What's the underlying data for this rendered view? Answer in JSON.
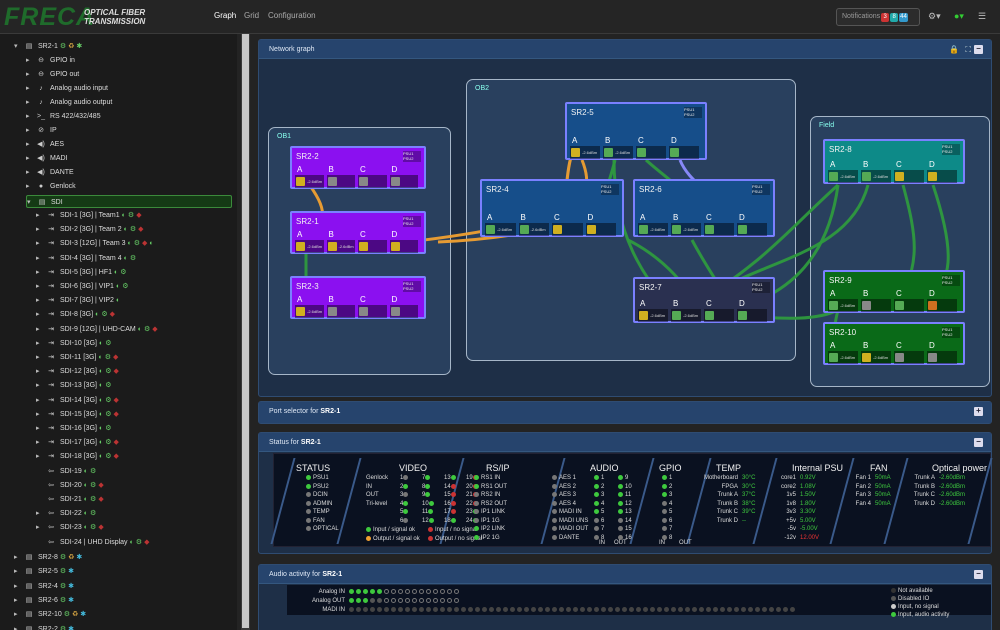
{
  "header": {
    "brand": "FRECA",
    "tagline1": "OPTICAL FIBER",
    "tagline2": "TRANSMISSION",
    "tabs": [
      "Graph",
      "Grid",
      "Configuration"
    ],
    "notifications_label": "Notifications",
    "notif_counts": [
      "3",
      "8",
      "44"
    ]
  },
  "sidebar": {
    "root": "SR2-1",
    "items": [
      "GPIO in",
      "GPIO out",
      "Analog audio input",
      "Analog audio output",
      "RS 422/432/485",
      "IP",
      "AES",
      "MADI",
      "DANTE",
      "Genlock",
      "SDI"
    ],
    "sdi": [
      "SDI-1 [3G] | Team1",
      "SDI-2 [3G] | Team 2",
      "SDI-3 [12G] | Team 3",
      "SDI-4 [3G] | Team 4",
      "SDI-5 [3G] | HF1",
      "SDI-6 [3G] | VIP1",
      "SDI-7 [3G] | VIP2",
      "SDI-8 [3G]",
      "SDI-9 [12G] | UHD-CAM",
      "SDI-10 [3G]",
      "SDI-11 [3G]",
      "SDI-12 [3G]",
      "SDI-13 [3G]",
      "SDI-14 [3G]",
      "SDI-15 [3G]",
      "SDI-16 [3G]",
      "SDI-17 [3G]",
      "SDI-18 [3G]",
      "SDI-19",
      "SDI-20",
      "SDI-21",
      "SDI-22",
      "SDI-23",
      "SDI-24 | UHD Display"
    ],
    "others": [
      "SR2-8",
      "SR2-5",
      "SR2-4",
      "SR2-6",
      "SR2-10",
      "SR2-2"
    ]
  },
  "panels": {
    "graph": "Network graph",
    "port_selector": "Port selector for",
    "status": "Status for",
    "audio": "Audio activity for",
    "device": "SR2-1"
  },
  "graph": {
    "groups": [
      "OB1",
      "OB2",
      "Field"
    ],
    "nodes": [
      "SR2-2",
      "SR2-1",
      "SR2-3",
      "SR2-5",
      "SR2-4",
      "SR2-6",
      "SR2-7",
      "SR2-8",
      "SR2-9",
      "SR2-10"
    ],
    "ports": [
      "A",
      "B",
      "C",
      "D"
    ],
    "psu": [
      "PSU1",
      "PSU2"
    ],
    "levels": [
      "-2.6dBm",
      "-2.6dBm",
      "-2.6dBm"
    ]
  },
  "status": {
    "headers": [
      "STATUS",
      "VIDEO",
      "RS/IP",
      "AUDIO",
      "GPIO",
      "TEMP",
      "Internal PSU",
      "FAN",
      "Optical power"
    ],
    "status_items": [
      "PSU1",
      "PSU2",
      "DCIN",
      "ADMIN",
      "TEMP",
      "FAN",
      "OPTICAL"
    ],
    "video_rows": [
      "Genlock",
      "IN",
      "OUT",
      "Tri-level"
    ],
    "video_legend": [
      "Input / signal ok",
      "Output / signal ok",
      "Input / no signal",
      "Output / no signal"
    ],
    "rsip": [
      "RS1 IN",
      "RS1 OUT",
      "RS2 IN",
      "RS2 OUT",
      "IP1 LINK",
      "IP1 1G",
      "IP2 LINK",
      "IP2 1G"
    ],
    "audio_rows": [
      "AES 1",
      "AES 2",
      "AES 3",
      "AES 4",
      "MADI IN",
      "MADI UNS",
      "MADI OUT",
      "DANTE"
    ],
    "inout": [
      "IN",
      "OUT"
    ],
    "temp": [
      [
        "Motherboard",
        "30°C"
      ],
      [
        "FPGA",
        "30°C"
      ],
      [
        "Trunk A",
        "37°C"
      ],
      [
        "Trunk B",
        "38°C"
      ],
      [
        "Trunk C",
        "39°C"
      ],
      [
        "Trunk D",
        "--"
      ]
    ],
    "psu": [
      [
        "core1",
        "0.92V"
      ],
      [
        "core2",
        "1.08V"
      ],
      [
        "1v5",
        "1.50V"
      ],
      [
        "1v8",
        "1.80V"
      ],
      [
        "3v3",
        "3.30V"
      ],
      [
        "+5v",
        "5.00V"
      ],
      [
        "-5v",
        "-5.00V"
      ],
      [
        "-12v",
        "12.00V"
      ]
    ],
    "fan": [
      [
        "Fan 1",
        "50mA"
      ],
      [
        "Fan 2",
        "50mA"
      ],
      [
        "Fan 3",
        "50mA"
      ],
      [
        "Fan 4",
        "50mA"
      ]
    ],
    "optical": [
      [
        "Trunk A",
        "-2.60dBm"
      ],
      [
        "Trunk B",
        "-2.60dBm"
      ],
      [
        "Trunk C",
        "-2.60dBm"
      ],
      [
        "Trunk D",
        "-2.60dBm"
      ]
    ]
  },
  "audio": {
    "rows": [
      "Analog IN",
      "Analog OUT",
      "MADI IN"
    ],
    "legend": [
      "Not available",
      "Disabled IO",
      "Input, no signal",
      "Input, audio activity"
    ]
  },
  "colors": {
    "accent": "#26446d",
    "ok": "#3ec93e",
    "warn": "#f0a030",
    "err": "#d03030"
  }
}
